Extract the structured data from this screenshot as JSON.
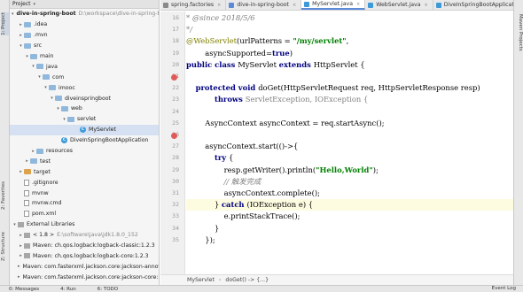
{
  "left_strip": {
    "project_tab": "1: Project",
    "favorites_tab": "2: Favorites",
    "structure_tab": "Z: Structure"
  },
  "right_strip": {
    "maven_tab": "Maven Projects"
  },
  "project_panel": {
    "title": "Project",
    "tree": [
      {
        "label": "dive-in-spring-boot",
        "note": "D:\\workspace\\dive-in-spring-boot",
        "icon": "folder",
        "level": 0,
        "arrow": "down",
        "bold": true
      },
      {
        "label": ".idea",
        "icon": "folder",
        "level": 1,
        "arrow": "right"
      },
      {
        "label": ".mvn",
        "icon": "folder",
        "level": 1,
        "arrow": "right"
      },
      {
        "label": "src",
        "icon": "folder",
        "level": 1,
        "arrow": "down"
      },
      {
        "label": "main",
        "icon": "folder",
        "level": 2,
        "arrow": "down"
      },
      {
        "label": "java",
        "icon": "folder",
        "level": 3,
        "arrow": "down"
      },
      {
        "label": "com",
        "icon": "folder",
        "level": 4,
        "arrow": "down"
      },
      {
        "label": "imooc",
        "icon": "folder",
        "level": 5,
        "arrow": "down"
      },
      {
        "label": "diveinspringboot",
        "icon": "folder",
        "level": 6,
        "arrow": "down"
      },
      {
        "label": "web",
        "icon": "folder",
        "level": 7,
        "arrow": "down"
      },
      {
        "label": "servlet",
        "icon": "folder",
        "level": 8,
        "arrow": "down"
      },
      {
        "label": "MyServlet",
        "icon": "java",
        "level": 10,
        "arrow": "",
        "selected": true
      },
      {
        "label": "DiveInSpringBootApplication",
        "icon": "java",
        "level": 7,
        "arrow": ""
      },
      {
        "label": "resources",
        "icon": "folder",
        "level": 3,
        "arrow": "right"
      },
      {
        "label": "test",
        "icon": "folder",
        "level": 2,
        "arrow": "right"
      },
      {
        "label": "target",
        "icon": "orange",
        "level": 1,
        "arrow": "right"
      },
      {
        "label": ".gitignore",
        "icon": "file",
        "level": 1,
        "arrow": ""
      },
      {
        "label": "mvnw",
        "icon": "file",
        "level": 1,
        "arrow": ""
      },
      {
        "label": "mvnw.cmd",
        "icon": "file",
        "level": 1,
        "arrow": ""
      },
      {
        "label": "pom.xml",
        "icon": "file",
        "level": 1,
        "arrow": ""
      },
      {
        "label": "External Libraries",
        "icon": "lib",
        "level": 0,
        "arrow": "down"
      },
      {
        "label": "< 1.8 >",
        "note": "E:\\software\\java\\jdk1.8.0_152",
        "icon": "lib",
        "level": 1,
        "arrow": "right"
      },
      {
        "label": "Maven: ch.qos.logback:logback-classic:1.2.3",
        "icon": "lib",
        "level": 1,
        "arrow": "right"
      },
      {
        "label": "Maven: ch.qos.logback:logback-core:1.2.3",
        "icon": "lib",
        "level": 1,
        "arrow": "right"
      },
      {
        "label": "Maven: com.fasterxml.jackson.core:jackson-annotations:2.9.5",
        "icon": "lib",
        "level": 1,
        "arrow": "right"
      },
      {
        "label": "Maven: com.fasterxml.jackson.core:jackson-core:2.9.5",
        "icon": "lib",
        "level": 1,
        "arrow": "right"
      }
    ]
  },
  "tabs": [
    {
      "label": "spring.factories",
      "color": "#8a8a8a",
      "active": false
    },
    {
      "label": "dive-in-spring-boot",
      "color": "#5a8ad8",
      "active": false
    },
    {
      "label": "MyServlet.java",
      "color": "#3d9ad9",
      "active": true
    },
    {
      "label": "WebServlet.java",
      "color": "#3d9ad9",
      "active": false
    },
    {
      "label": "DiveInSpringBootApplication.java",
      "color": "#3d9ad9",
      "active": false
    }
  ],
  "editor": {
    "line_numbers": [
      "16",
      "17",
      "18",
      "19",
      "20",
      "21",
      "22",
      "23",
      "24",
      "25",
      "26",
      "27",
      "28",
      "29",
      "30",
      "31",
      "32",
      "33",
      "34",
      "35"
    ],
    "gutter_marks": [
      "21",
      "26"
    ],
    "lines": [
      [
        {
          "t": "* ",
          "c": "cm"
        },
        {
          "t": "@since",
          "c": "cm"
        },
        {
          "t": " 2018/5/6",
          "c": "cm"
        }
      ],
      [
        {
          "t": "*/",
          "c": "cm"
        }
      ],
      [
        {
          "t": "@WebServlet",
          "c": "ann"
        },
        {
          "t": "(urlPatterns = ",
          "c": "type"
        },
        {
          "t": "\"/my/servlet\"",
          "c": "str"
        },
        {
          "t": ",",
          "c": "type"
        }
      ],
      [
        {
          "t": "        asyncSupported=",
          "c": "type"
        },
        {
          "t": "true",
          "c": "kw"
        },
        {
          "t": ")",
          "c": "type"
        }
      ],
      [
        {
          "t": "public class ",
          "c": "kw"
        },
        {
          "t": "MyServlet ",
          "c": "type"
        },
        {
          "t": "extends ",
          "c": "kw"
        },
        {
          "t": "HttpServlet {",
          "c": "type"
        }
      ],
      [
        {
          "t": "",
          "c": "type"
        }
      ],
      [
        {
          "t": "    ",
          "c": "type"
        },
        {
          "t": "protected void ",
          "c": "kw"
        },
        {
          "t": "doGet(HttpServletRequest req, HttpServletResponse resp)",
          "c": "type"
        }
      ],
      [
        {
          "t": "            ",
          "c": "type"
        },
        {
          "t": "throws ",
          "c": "kw"
        },
        {
          "t": "ServletException, IOException {",
          "c": "cm2"
        }
      ],
      [
        {
          "t": "",
          "c": "type"
        }
      ],
      [
        {
          "t": "        AsyncContext asyncContext = req.startAsync();",
          "c": "type"
        }
      ],
      [
        {
          "t": "",
          "c": "type"
        }
      ],
      [
        {
          "t": "        asyncContext.start(()->{",
          "c": "type"
        }
      ],
      [
        {
          "t": "            ",
          "c": "type"
        },
        {
          "t": "try ",
          "c": "kw"
        },
        {
          "t": "{",
          "c": "type"
        }
      ],
      [
        {
          "t": "                resp.getWriter().println(",
          "c": "type"
        },
        {
          "t": "\"Hello,World\"",
          "c": "str"
        },
        {
          "t": ");",
          "c": "type"
        }
      ],
      [
        {
          "t": "                ",
          "c": "type"
        },
        {
          "t": "// 触发完成",
          "c": "cm"
        }
      ],
      [
        {
          "t": "                asyncContext.complete();",
          "c": "type"
        }
      ],
      [
        {
          "t": "            } ",
          "c": "type"
        },
        {
          "t": "catch ",
          "c": "kw"
        },
        {
          "t": "(IOException e) {",
          "c": "type"
        }
      ],
      [
        {
          "t": "                e.printStackTrace();",
          "c": "type"
        }
      ],
      [
        {
          "t": "            }",
          "c": "type"
        }
      ],
      [
        {
          "t": "        });",
          "c": "type"
        }
      ]
    ],
    "highlight_line": "32"
  },
  "breadcrumb": [
    "MyServlet",
    "doGet() -> {...}"
  ],
  "status": {
    "messages": "0: Messages",
    "run": "4: Run",
    "todo": "6: TODO",
    "event_log": "Event Log"
  }
}
